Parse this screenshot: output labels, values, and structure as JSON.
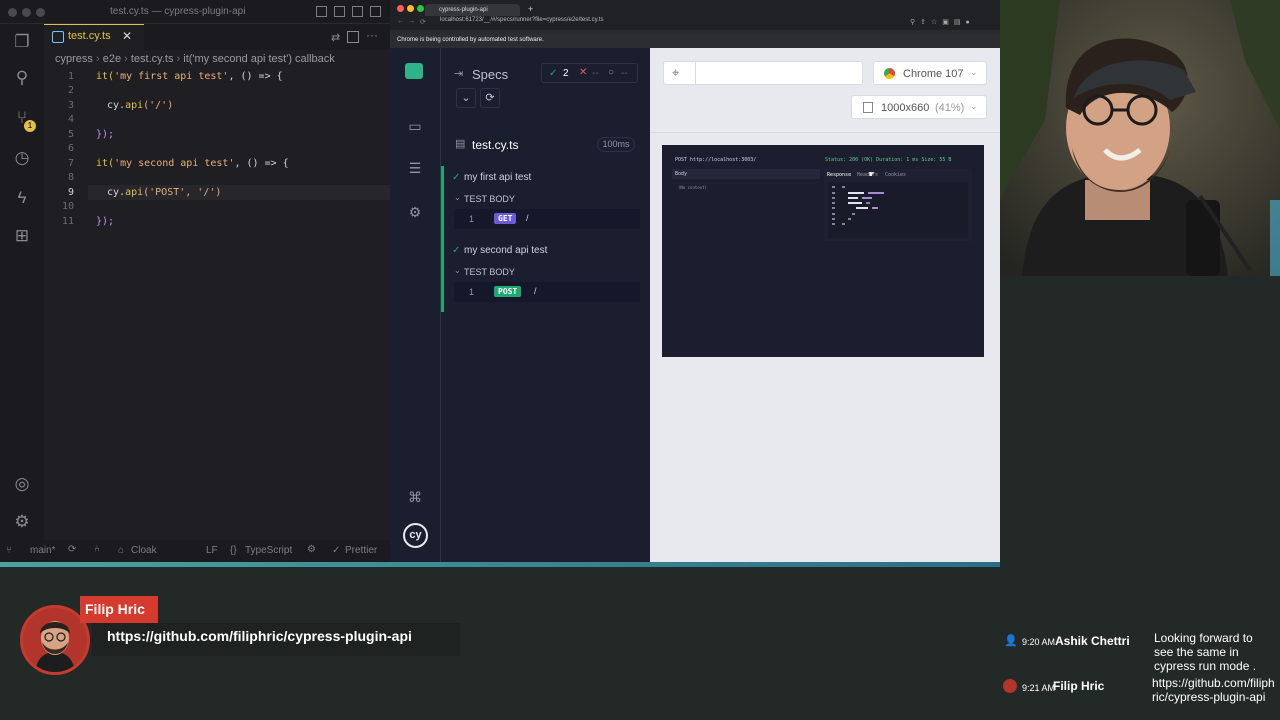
{
  "vscode": {
    "window_title": "test.cy.ts — cypress-plugin-api",
    "tab_label": "test.cy.ts",
    "breadcrumb": [
      "cypress",
      "e2e",
      "test.cy.ts",
      "it('my second api test') callback"
    ],
    "line_numbers": [
      "1",
      "2",
      "3",
      "4",
      "5",
      "6",
      "7",
      "8",
      "9",
      "10",
      "11"
    ],
    "code": {
      "l1_fn": "it(",
      "l1_str": "'my first api test'",
      "l1_rest": ", () => {",
      "l3_obj": "cy.",
      "l3_fn": "api",
      "l3_arg": "('/')",
      "l5": "});",
      "l7_fn": "it(",
      "l7_str": "'my second api test'",
      "l7_rest": ", () => {",
      "l9_obj": "cy.",
      "l9_fn": "api",
      "l9_arg": "('POST', '/')",
      "l11": "});"
    },
    "status": {
      "branch": "main*",
      "cloak": "Cloak",
      "eol": "LF",
      "language": "TypeScript",
      "formatter": "Prettier"
    },
    "notification_count": "1"
  },
  "browser": {
    "tab_title": "cypress-plugin-api",
    "url": "localhost:61723/__/#/specs/runner?file=cypress/e2e/test.cy.ts",
    "automation_notice": "Chrome is being controlled by automated test software."
  },
  "cypress": {
    "specs_label": "Specs",
    "passed": "2",
    "failed": "--",
    "pending": "--",
    "spec_file": "test.cy.ts",
    "duration": "100ms",
    "tests": [
      {
        "title": "my first api test",
        "body_label": "TEST BODY",
        "line": "1",
        "method": "GET",
        "path": "/",
        "method_color": "#6b5bd6"
      },
      {
        "title": "my second api test",
        "body_label": "TEST BODY",
        "line": "1",
        "method": "POST",
        "path": "/",
        "method_color": "#1fa971"
      }
    ],
    "browser_label": "Chrome 107",
    "viewport_label": "1000x660",
    "viewport_scale": "(41%)",
    "aut": {
      "request": "POST http://localhost:3003/",
      "status": "Status: 200 (OK) Duration: 1 ms Size: 55 B",
      "body_label": "Body",
      "no_content": "(No content)",
      "tabs": [
        "Response",
        "Headers",
        "Cookies"
      ]
    }
  },
  "lower_third": {
    "name": "Filip Hric",
    "link": "https://github.com/filiphric/cypress-plugin-api"
  },
  "chat": [
    {
      "time": "9:20 AM",
      "author": "Ashik Chettri",
      "message": "Looking forward to see the same in cypress run mode ."
    },
    {
      "time": "9:21 AM",
      "author": "Filip Hric",
      "message": "https://github.com/filiphric/cypress-plugin-api"
    }
  ]
}
